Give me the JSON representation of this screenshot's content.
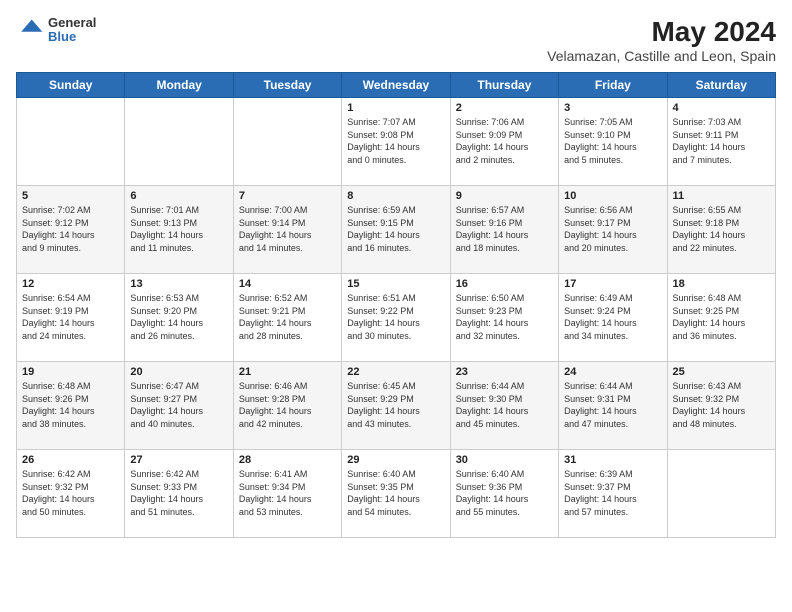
{
  "header": {
    "logo_line1": "General",
    "logo_line2": "Blue",
    "month_year": "May 2024",
    "location": "Velamazan, Castille and Leon, Spain"
  },
  "days_of_week": [
    "Sunday",
    "Monday",
    "Tuesday",
    "Wednesday",
    "Thursday",
    "Friday",
    "Saturday"
  ],
  "weeks": [
    [
      {
        "day": "",
        "content": ""
      },
      {
        "day": "",
        "content": ""
      },
      {
        "day": "",
        "content": ""
      },
      {
        "day": "1",
        "content": "Sunrise: 7:07 AM\nSunset: 9:08 PM\nDaylight: 14 hours\nand 0 minutes."
      },
      {
        "day": "2",
        "content": "Sunrise: 7:06 AM\nSunset: 9:09 PM\nDaylight: 14 hours\nand 2 minutes."
      },
      {
        "day": "3",
        "content": "Sunrise: 7:05 AM\nSunset: 9:10 PM\nDaylight: 14 hours\nand 5 minutes."
      },
      {
        "day": "4",
        "content": "Sunrise: 7:03 AM\nSunset: 9:11 PM\nDaylight: 14 hours\nand 7 minutes."
      }
    ],
    [
      {
        "day": "5",
        "content": "Sunrise: 7:02 AM\nSunset: 9:12 PM\nDaylight: 14 hours\nand 9 minutes."
      },
      {
        "day": "6",
        "content": "Sunrise: 7:01 AM\nSunset: 9:13 PM\nDaylight: 14 hours\nand 11 minutes."
      },
      {
        "day": "7",
        "content": "Sunrise: 7:00 AM\nSunset: 9:14 PM\nDaylight: 14 hours\nand 14 minutes."
      },
      {
        "day": "8",
        "content": "Sunrise: 6:59 AM\nSunset: 9:15 PM\nDaylight: 14 hours\nand 16 minutes."
      },
      {
        "day": "9",
        "content": "Sunrise: 6:57 AM\nSunset: 9:16 PM\nDaylight: 14 hours\nand 18 minutes."
      },
      {
        "day": "10",
        "content": "Sunrise: 6:56 AM\nSunset: 9:17 PM\nDaylight: 14 hours\nand 20 minutes."
      },
      {
        "day": "11",
        "content": "Sunrise: 6:55 AM\nSunset: 9:18 PM\nDaylight: 14 hours\nand 22 minutes."
      }
    ],
    [
      {
        "day": "12",
        "content": "Sunrise: 6:54 AM\nSunset: 9:19 PM\nDaylight: 14 hours\nand 24 minutes."
      },
      {
        "day": "13",
        "content": "Sunrise: 6:53 AM\nSunset: 9:20 PM\nDaylight: 14 hours\nand 26 minutes."
      },
      {
        "day": "14",
        "content": "Sunrise: 6:52 AM\nSunset: 9:21 PM\nDaylight: 14 hours\nand 28 minutes."
      },
      {
        "day": "15",
        "content": "Sunrise: 6:51 AM\nSunset: 9:22 PM\nDaylight: 14 hours\nand 30 minutes."
      },
      {
        "day": "16",
        "content": "Sunrise: 6:50 AM\nSunset: 9:23 PM\nDaylight: 14 hours\nand 32 minutes."
      },
      {
        "day": "17",
        "content": "Sunrise: 6:49 AM\nSunset: 9:24 PM\nDaylight: 14 hours\nand 34 minutes."
      },
      {
        "day": "18",
        "content": "Sunrise: 6:48 AM\nSunset: 9:25 PM\nDaylight: 14 hours\nand 36 minutes."
      }
    ],
    [
      {
        "day": "19",
        "content": "Sunrise: 6:48 AM\nSunset: 9:26 PM\nDaylight: 14 hours\nand 38 minutes."
      },
      {
        "day": "20",
        "content": "Sunrise: 6:47 AM\nSunset: 9:27 PM\nDaylight: 14 hours\nand 40 minutes."
      },
      {
        "day": "21",
        "content": "Sunrise: 6:46 AM\nSunset: 9:28 PM\nDaylight: 14 hours\nand 42 minutes."
      },
      {
        "day": "22",
        "content": "Sunrise: 6:45 AM\nSunset: 9:29 PM\nDaylight: 14 hours\nand 43 minutes."
      },
      {
        "day": "23",
        "content": "Sunrise: 6:44 AM\nSunset: 9:30 PM\nDaylight: 14 hours\nand 45 minutes."
      },
      {
        "day": "24",
        "content": "Sunrise: 6:44 AM\nSunset: 9:31 PM\nDaylight: 14 hours\nand 47 minutes."
      },
      {
        "day": "25",
        "content": "Sunrise: 6:43 AM\nSunset: 9:32 PM\nDaylight: 14 hours\nand 48 minutes."
      }
    ],
    [
      {
        "day": "26",
        "content": "Sunrise: 6:42 AM\nSunset: 9:32 PM\nDaylight: 14 hours\nand 50 minutes."
      },
      {
        "day": "27",
        "content": "Sunrise: 6:42 AM\nSunset: 9:33 PM\nDaylight: 14 hours\nand 51 minutes."
      },
      {
        "day": "28",
        "content": "Sunrise: 6:41 AM\nSunset: 9:34 PM\nDaylight: 14 hours\nand 53 minutes."
      },
      {
        "day": "29",
        "content": "Sunrise: 6:40 AM\nSunset: 9:35 PM\nDaylight: 14 hours\nand 54 minutes."
      },
      {
        "day": "30",
        "content": "Sunrise: 6:40 AM\nSunset: 9:36 PM\nDaylight: 14 hours\nand 55 minutes."
      },
      {
        "day": "31",
        "content": "Sunrise: 6:39 AM\nSunset: 9:37 PM\nDaylight: 14 hours\nand 57 minutes."
      },
      {
        "day": "",
        "content": ""
      }
    ]
  ]
}
